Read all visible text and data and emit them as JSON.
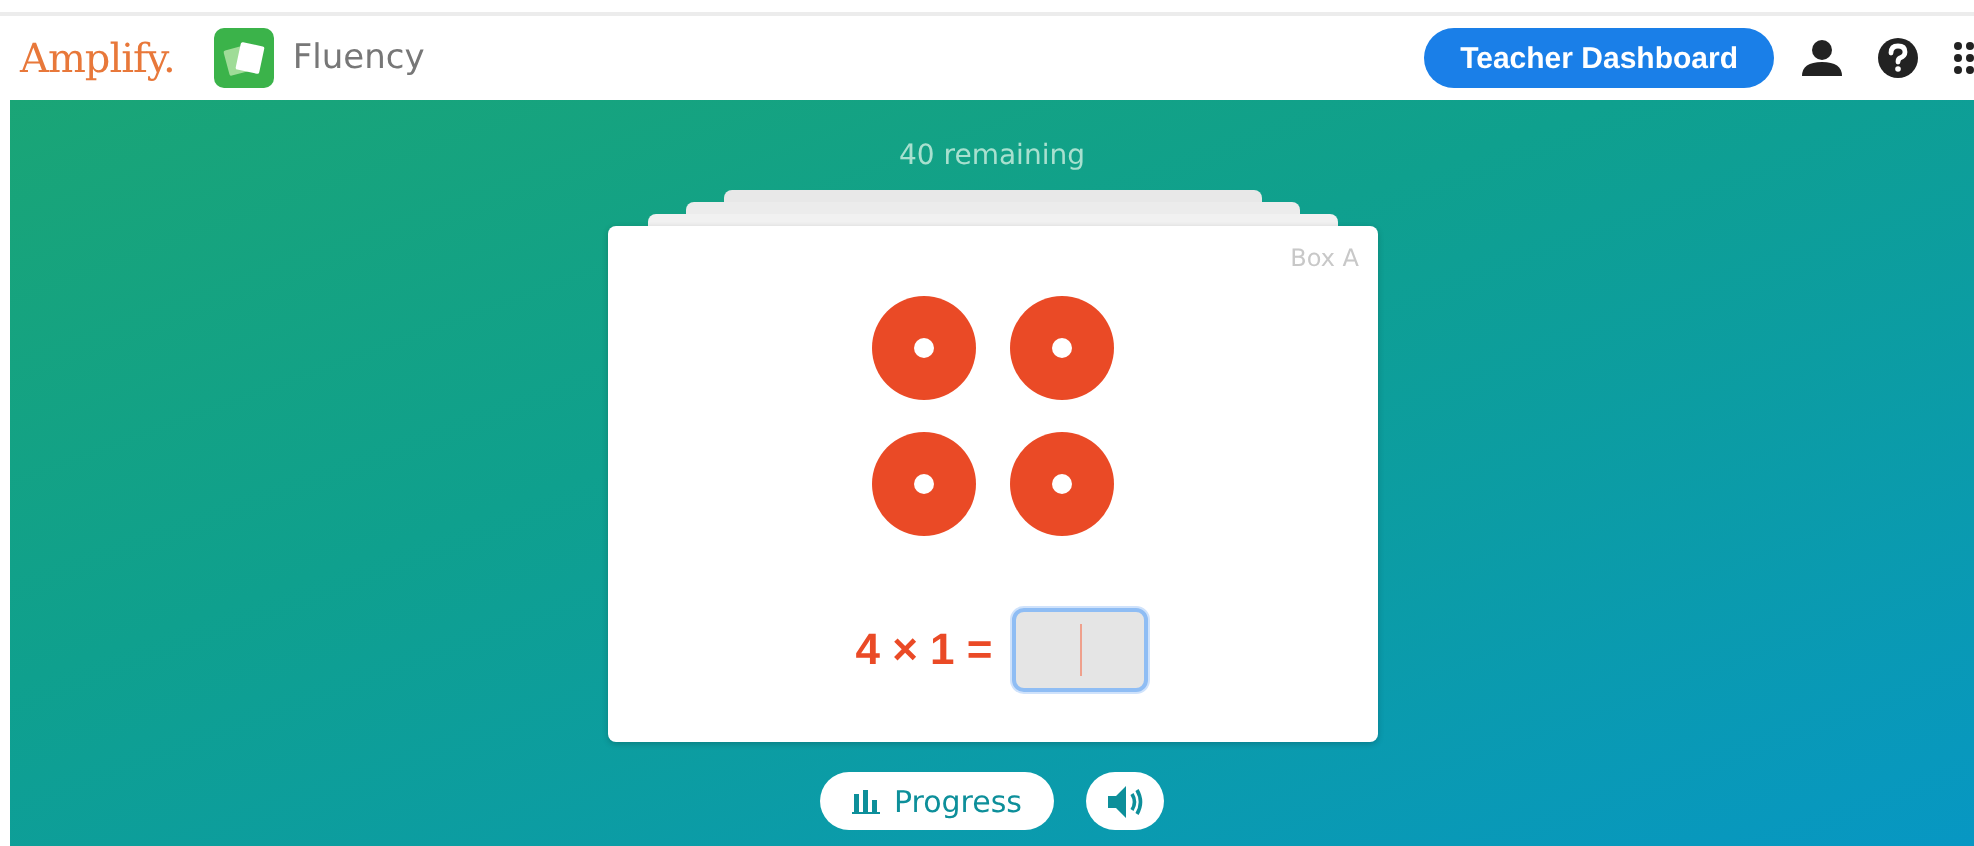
{
  "header": {
    "brand": "Amplify.",
    "app_name": "Fluency",
    "dashboard_button": "Teacher Dashboard"
  },
  "remaining": "40 remaining",
  "card": {
    "box_label": "Box A",
    "dots": [
      {
        "kind": "counter"
      },
      {
        "kind": "counter"
      },
      {
        "kind": "counter"
      },
      {
        "kind": "counter"
      }
    ],
    "equation": "4 × 1 ="
  },
  "footer": {
    "progress_button": "Progress"
  }
}
